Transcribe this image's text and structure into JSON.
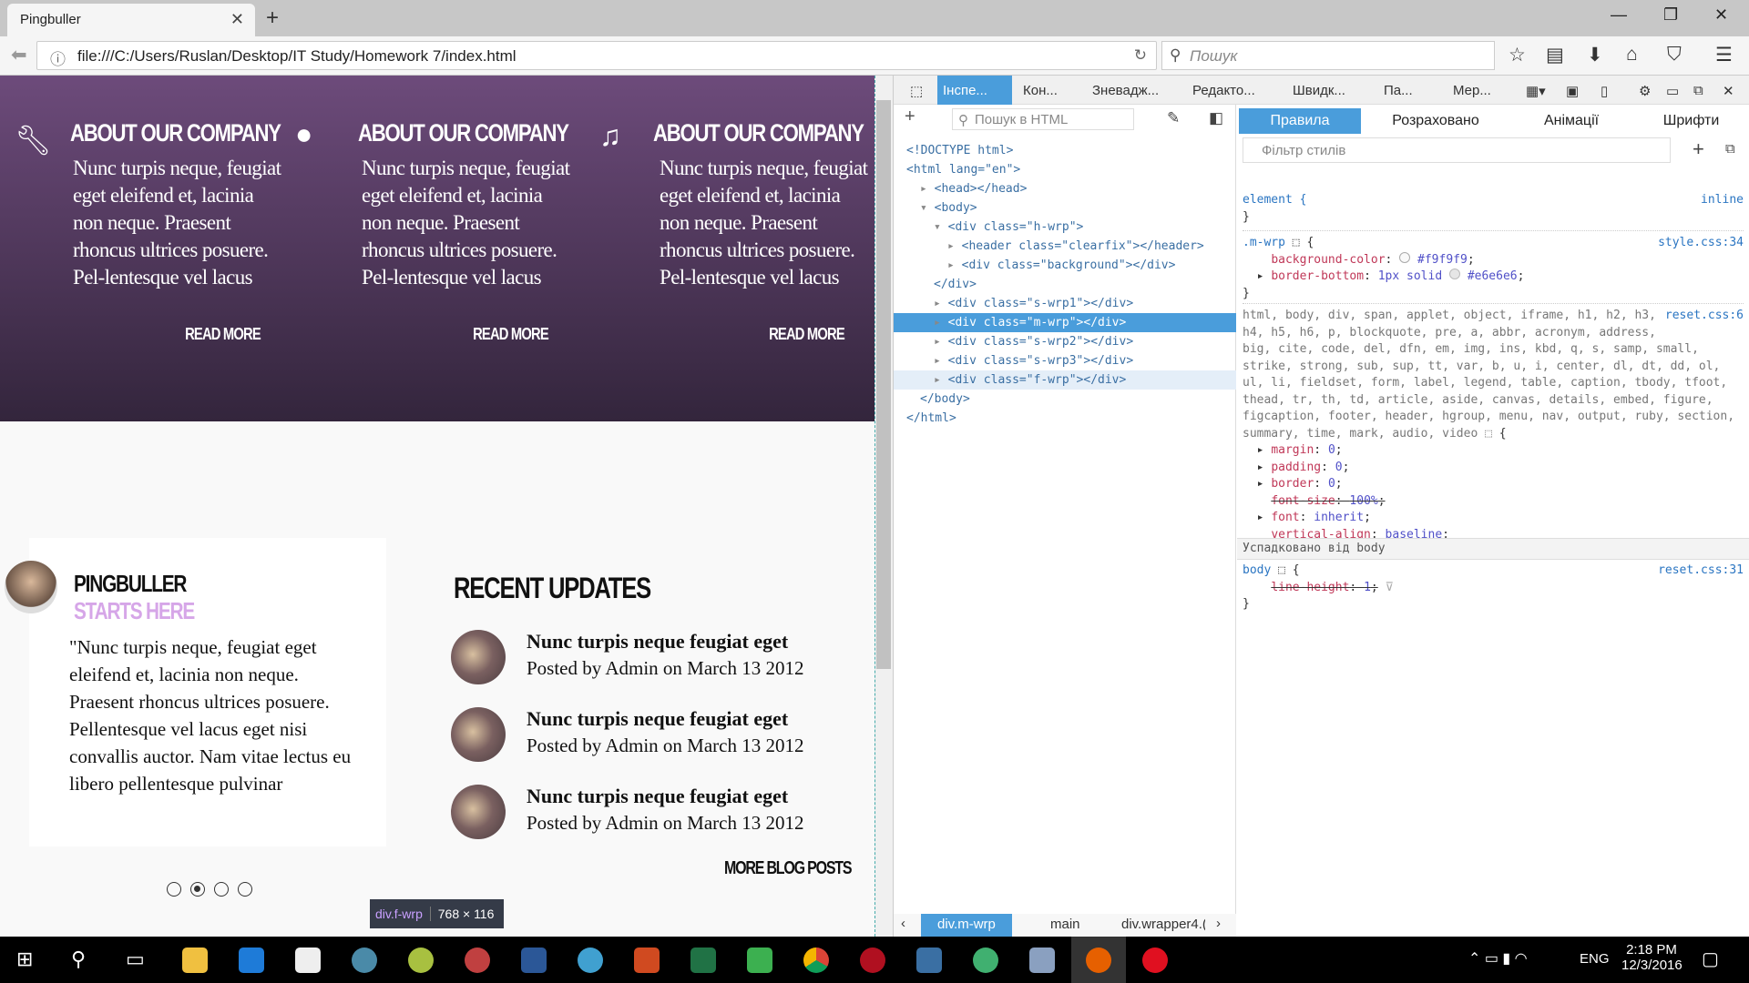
{
  "browser": {
    "tab_title": "Pingbuller",
    "url": "file:///C:/Users/Ruslan/Desktop/IT Study/Homework 7/index.html",
    "search_placeholder": "Пошук"
  },
  "page": {
    "features": [
      {
        "icon": "wrench-icon",
        "title": "ABOUT OUR COMPANY",
        "text": "Nunc turpis neque, feugiat eget eleifend et, lacinia non neque. Praesent rhoncus ultrices posuere. Pel-lentesque vel lacus",
        "link": "READ MORE"
      },
      {
        "icon": "speech-bubble-icon",
        "title": "ABOUT OUR COMPANY",
        "text": "Nunc turpis neque, feugiat eget eleifend et, lacinia non neque. Praesent rhoncus ultrices posuere. Pel-lentesque vel lacus",
        "link": "READ MORE"
      },
      {
        "icon": "music-note-icon",
        "title": "ABOUT OUR COMPANY",
        "text": "Nunc turpis neque, feugiat eget eleifend et, lacinia non neque. Praesent rhoncus ultrices posuere. Pel-lentesque vel lacus",
        "link": "READ MORE"
      }
    ],
    "testimonial": {
      "name": "PINGBULLER",
      "subtitle": "STARTS HERE",
      "quote": "\"Nunc turpis neque, feugiat eget eleifend et, lacinia non neque. Praesent rhoncus ultrices posuere. Pellentesque vel lacus eget nisi convallis auctor. Nam vitae lectus eu libero pellentesque pulvinar",
      "slides": 4,
      "active_slide": 2
    },
    "updates": {
      "title": "RECENT UPDATES",
      "posts": [
        {
          "title": "Nunc turpis neque feugiat eget",
          "meta": "Posted by Admin on March 13 2012"
        },
        {
          "title": "Nunc turpis neque feugiat eget",
          "meta": "Posted by Admin on March 13 2012"
        },
        {
          "title": "Nunc turpis neque feugiat eget",
          "meta": "Posted by Admin on March 13 2012"
        }
      ],
      "more": "MORE BLOG POSTS"
    },
    "tooltip": {
      "tag": "div.f-wrp",
      "size": "768 × 116"
    }
  },
  "devtools": {
    "tabs": [
      "Інспе...",
      "Кон...",
      "Зневадж...",
      "Редакто...",
      "Швидк...",
      "Па...",
      "Мер..."
    ],
    "html_search": "Пошук в HTML",
    "tree": [
      {
        "text": "<!DOCTYPE html>"
      },
      {
        "text": "<html lang=\"en\">"
      },
      {
        "text": "<head></head>"
      },
      {
        "text": "<body>"
      },
      {
        "text": "<div class=\"h-wrp\">"
      },
      {
        "text": "<header class=\"clearfix\"></header>"
      },
      {
        "text": "<div class=\"background\"></div>"
      },
      {
        "text": "</div>"
      },
      {
        "text": "<div class=\"s-wrp1\"></div>"
      },
      {
        "text": "<div class=\"m-wrp\"></div>"
      },
      {
        "text": "<div class=\"s-wrp2\"></div>"
      },
      {
        "text": "<div class=\"s-wrp3\"></div>"
      },
      {
        "text": "<div class=\"f-wrp\"></div>"
      },
      {
        "text": "</body>"
      },
      {
        "text": "</html>"
      }
    ],
    "rule_tabs": [
      "Правила",
      "Розраховано",
      "Анімації",
      "Шрифти"
    ],
    "filter_placeholder": "Фільтр стилів",
    "rules": {
      "element": {
        "selector": "element {",
        "source": "inline"
      },
      "mwrp": {
        "selector": ".m-wrp",
        "source": "style.css:34",
        "bg_prop": "background-color",
        "bg_val": "#f9f9f9",
        "bb_prop": "border-bottom",
        "bb_val": "1px solid",
        "bb_color": "#e6e6e6"
      },
      "reset": {
        "selector": "html, body, div, span, applet, object, iframe, h1, h2, h3,\nh4, h5, h6, p, blockquote, pre, a, abbr, acronym, address,\nbig, cite, code, del, dfn, em, img, ins, kbd, q, s, samp, small,\nstrike, strong, sub, sup, tt, var, b, u, i, center, dl, dt, dd, ol,\nul, li, fieldset, form, label, legend, table, caption, tbody, tfoot,\nthead, tr, th, td, article, aside, canvas, details, embed, figure,\nfigcaption, footer, header, hgroup, menu, nav, output, ruby, section,\nsummary, time, mark, audio, video",
        "source": "reset.css:6",
        "decls": [
          {
            "p": "margin",
            "v": "0"
          },
          {
            "p": "padding",
            "v": "0"
          },
          {
            "p": "border",
            "v": "0"
          },
          {
            "p": "font-size",
            "v": "100%"
          },
          {
            "p": "font",
            "v": "inherit"
          },
          {
            "p": "vertical-align",
            "v": "baseline"
          }
        ]
      },
      "inherited_label": "Успадковано від body",
      "body": {
        "selector": "body",
        "source": "reset.css:31",
        "prop": "line-height",
        "val": "1"
      }
    },
    "breadcrumbs": [
      "div.m-wrp",
      "main",
      "div.wrapper4.("
    ]
  },
  "taskbar": {
    "lang": "ENG",
    "time": "2:18 PM",
    "date": "12/3/2016"
  }
}
